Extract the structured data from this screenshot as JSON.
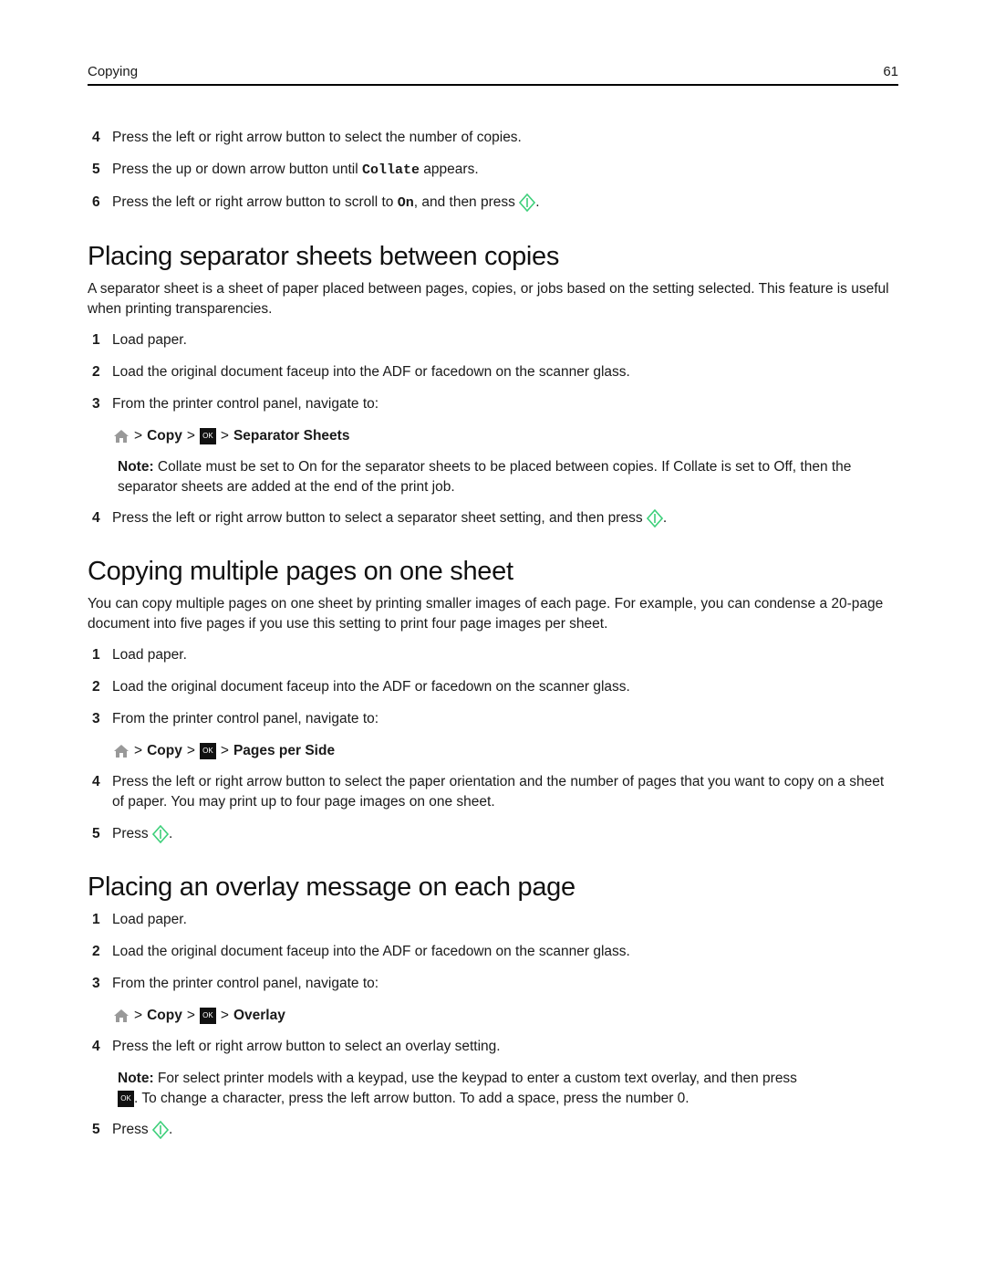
{
  "header": {
    "section": "Copying",
    "page_number": "61"
  },
  "top_steps": [
    {
      "num": "4",
      "text": "Press the left or right arrow button to select the number of copies."
    },
    {
      "num": "5",
      "pre": "Press the up or down arrow button until ",
      "code": "Collate",
      "post": " appears."
    },
    {
      "num": "6",
      "pre": "Press the left or right arrow button to scroll to ",
      "code": "On",
      "post": ", and then press",
      "end": "."
    }
  ],
  "sections": [
    {
      "title": "Placing separator sheets between copies",
      "intro": "A separator sheet is a sheet of paper placed between pages, copies, or jobs based on the setting selected. This feature is useful when printing transparencies.",
      "steps": [
        "Load paper.",
        "Load the original document faceup into the ADF or facedown on the scanner glass.",
        "From the printer control panel, navigate to:"
      ],
      "path": {
        "copy": "Copy",
        "ok": "OK",
        "target": "Separator Sheets"
      },
      "note_label": "Note:",
      "note": " Collate must be set to On for the separator sheets to be placed between copies. If Collate is set to Off, then the separator sheets are added at the end of the print job.",
      "last_step": "Press the left or right arrow button to select a separator sheet setting, and then press"
    },
    {
      "title": "Copying multiple pages on one sheet",
      "intro": "You can copy multiple pages on one sheet by printing smaller images of each page. For example, you can condense a 20-page document into five pages if you use this setting to print four page images per sheet.",
      "steps": [
        "Load paper.",
        "Load the original document faceup into the ADF or facedown on the scanner glass.",
        "From the printer control panel, navigate to:"
      ],
      "path": {
        "copy": "Copy",
        "ok": "OK",
        "target": "Pages per Side"
      },
      "step4": "Press the left or right arrow button to select the paper orientation and the number of pages that you want to copy on a sheet of paper. You may print up to four page images on one sheet.",
      "step5": "Press"
    },
    {
      "title": "Placing an overlay message on each page",
      "steps": [
        "Load paper.",
        "Load the original document faceup into the ADF or facedown on the scanner glass.",
        "From the printer control panel, navigate to:"
      ],
      "path": {
        "copy": "Copy",
        "ok": "OK",
        "target": "Overlay"
      },
      "step4": "Press the left or right arrow button to select an overlay setting.",
      "note_label": "Note:",
      "note_a": " For select printer models with a keypad, use the keypad to enter a custom text overlay, and then press",
      "note_b": ". To change a character, press the left arrow button. To add a space, press the number 0.",
      "step5": "Press"
    }
  ],
  "punct": {
    "gt": ">",
    "period": "."
  }
}
